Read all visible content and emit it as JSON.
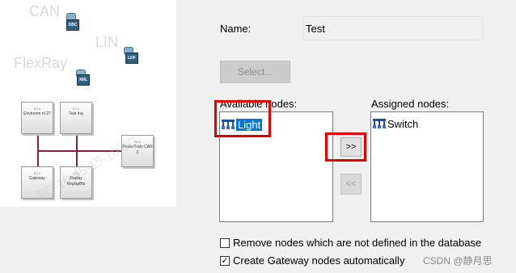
{
  "network_image": {
    "bus_labels": [
      "CAN",
      "LIN",
      "FlexRay"
    ],
    "db_badges": [
      "DBC",
      "LDF",
      "XML"
    ],
    "ecus": [
      {
        "type": "ECU",
        "name": "Environm nt 27"
      },
      {
        "type": "ECU",
        "name": "Test Inq"
      },
      {
        "type": "ECU",
        "name": "PowerTrain CAN 2"
      },
      {
        "type": "ECU",
        "name": "Gateway"
      },
      {
        "type": "ECU",
        "name": "Replay ReplayBlo"
      }
    ],
    "line_color": "#8b1a47"
  },
  "form": {
    "name_label": "Name:",
    "name_value": "Test",
    "select_button": "Select...",
    "available_label": "Available nodes:",
    "assigned_label": "Assigned nodes:",
    "available_nodes": [
      {
        "label": "Light",
        "selected": true,
        "icon": "network-node-icon"
      }
    ],
    "assigned_nodes": [
      {
        "label": "Switch",
        "icon": "network-node-icon"
      }
    ],
    "add_button": ">>",
    "remove_button": "<<",
    "checkboxes": [
      {
        "label": "Remove nodes which are not defined in the database",
        "checked": false
      },
      {
        "label": "Create Gateway nodes automatically",
        "checked": true
      }
    ]
  },
  "watermark": {
    "text": "8C-16-45-15-10-8C",
    "csdn": "CSDN @静月思"
  },
  "colors": {
    "highlight": "#e00000",
    "selection": "#0078d7",
    "background": "#f0f0f0"
  }
}
